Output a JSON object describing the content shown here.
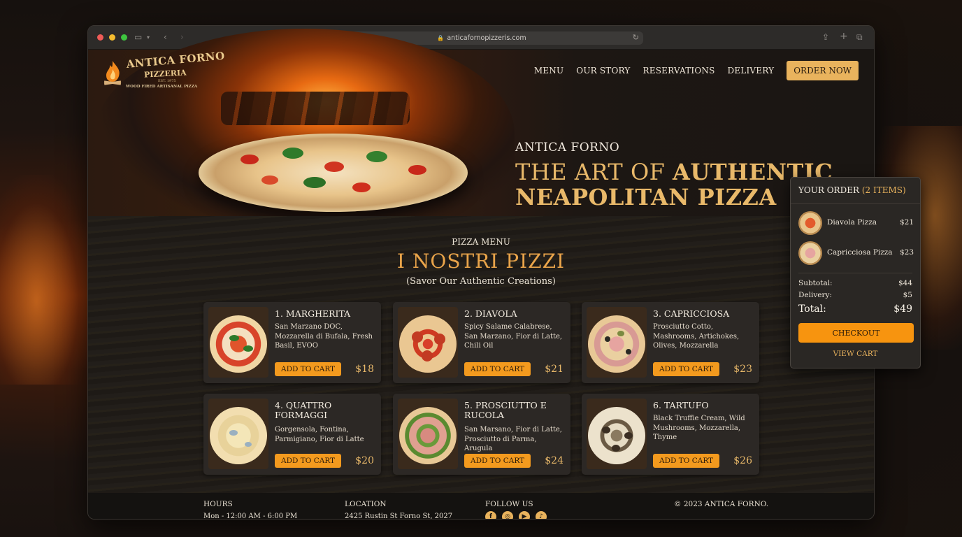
{
  "browser": {
    "url": "anticafornopizzeris.com"
  },
  "brand": {
    "name": "ANTICA FORNO",
    "sub": "PIZZERIA",
    "established": "EST. 1975",
    "tagline": "WOOD FIRED ARTISANAL PIZZA"
  },
  "nav": {
    "items": [
      "MENU",
      "OUR STORY",
      "RESERVATIONS",
      "DELIVERY"
    ],
    "cta": "ORDER NOW"
  },
  "hero": {
    "kicker": "ANTICA FORNO",
    "title_light": "THE ART OF ",
    "title_bold_1": "AUTHENTIC",
    "title_bold_2": "NEAPOLITAN PIZZA"
  },
  "menu": {
    "kicker": "PIZZA MENU",
    "title": "I NOSTRI PIZZI",
    "subtitle": "(Savor Our Authentic Creations)",
    "add_label": "ADD TO CART",
    "items": [
      {
        "name": "1. MARGHERITA",
        "desc": "San Marzano DOC, Mozzarella di Bufala, Fresh Basil, EVOO",
        "price": "$18"
      },
      {
        "name": "2. DIAVOLA",
        "desc": "Spicy Salame Calabrese, San Marzano, Fior di Latte, Chili Oil",
        "price": "$21"
      },
      {
        "name": "3. CAPRICCIOSA",
        "desc": "Prosciutto Cotto, Mashrooms, Artichokes, Olives, Mozzarella",
        "price": "$23"
      },
      {
        "name": "4. QUATTRO FORMAGGI",
        "desc": "Gorgensola, Fontina, Parmigiano, Fior di Latte",
        "price": "$20"
      },
      {
        "name": "5. PROSCIUTTO E RUCOLA",
        "desc": "San Marsano, Fior di Latte, Prosciutto di Parma, Arugula",
        "price": "$24"
      },
      {
        "name": "6. TARTUFO",
        "desc": "Black Truffie Cream, Wild Mushrooms, Mozzarella, Thyme",
        "price": "$26"
      }
    ]
  },
  "footer": {
    "hours_label": "HOURS",
    "hours_value": "Mon - 12:00 AM - 6:00 PM",
    "location_label": "LOCATION",
    "location_value": "2425 Rustin St Forno St, 2027",
    "follow_label": "FOLLOW US",
    "social": [
      "facebook-icon",
      "instagram-icon",
      "youtube-icon",
      "tiktok-icon"
    ],
    "copyright": "© 2023 ANTICA FORNO."
  },
  "cart": {
    "title": "YOUR ORDER",
    "count": "(2 ITEMS)",
    "items": [
      {
        "name": "Diavola Pizza",
        "price": "$21"
      },
      {
        "name": "Capricciosa Pizza",
        "price": "$23"
      }
    ],
    "subtotal_label": "Subtotal:",
    "subtotal": "$44",
    "delivery_label": "Delivery:",
    "delivery": "$5",
    "total_label": "Total:",
    "total": "$49",
    "checkout_label": "CHECKOUT",
    "view_cart_label": "VIEW CART"
  },
  "colors": {
    "accent": "#e9b35d",
    "button": "#f39a1e",
    "price": "#e9b96a"
  }
}
